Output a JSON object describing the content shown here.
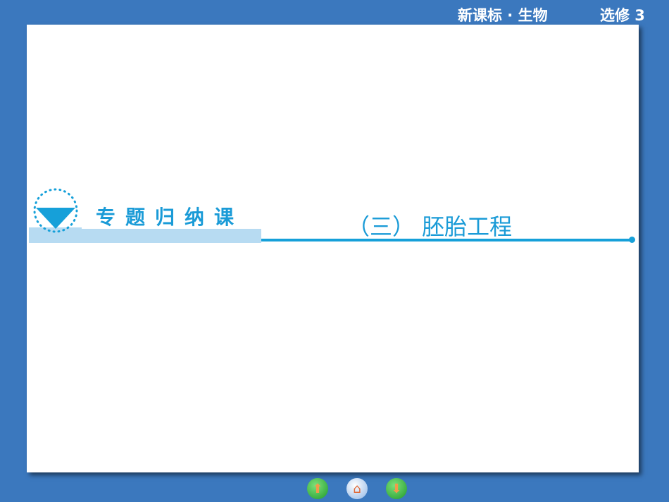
{
  "header": {
    "subject": "新课标 · 生物",
    "volume": "选修 3"
  },
  "slide": {
    "section_label": "专题归纳课",
    "title": "（三）  胚胎工程"
  },
  "nav": {
    "prev": "previous-icon",
    "home": "home-icon",
    "next": "next-icon"
  }
}
